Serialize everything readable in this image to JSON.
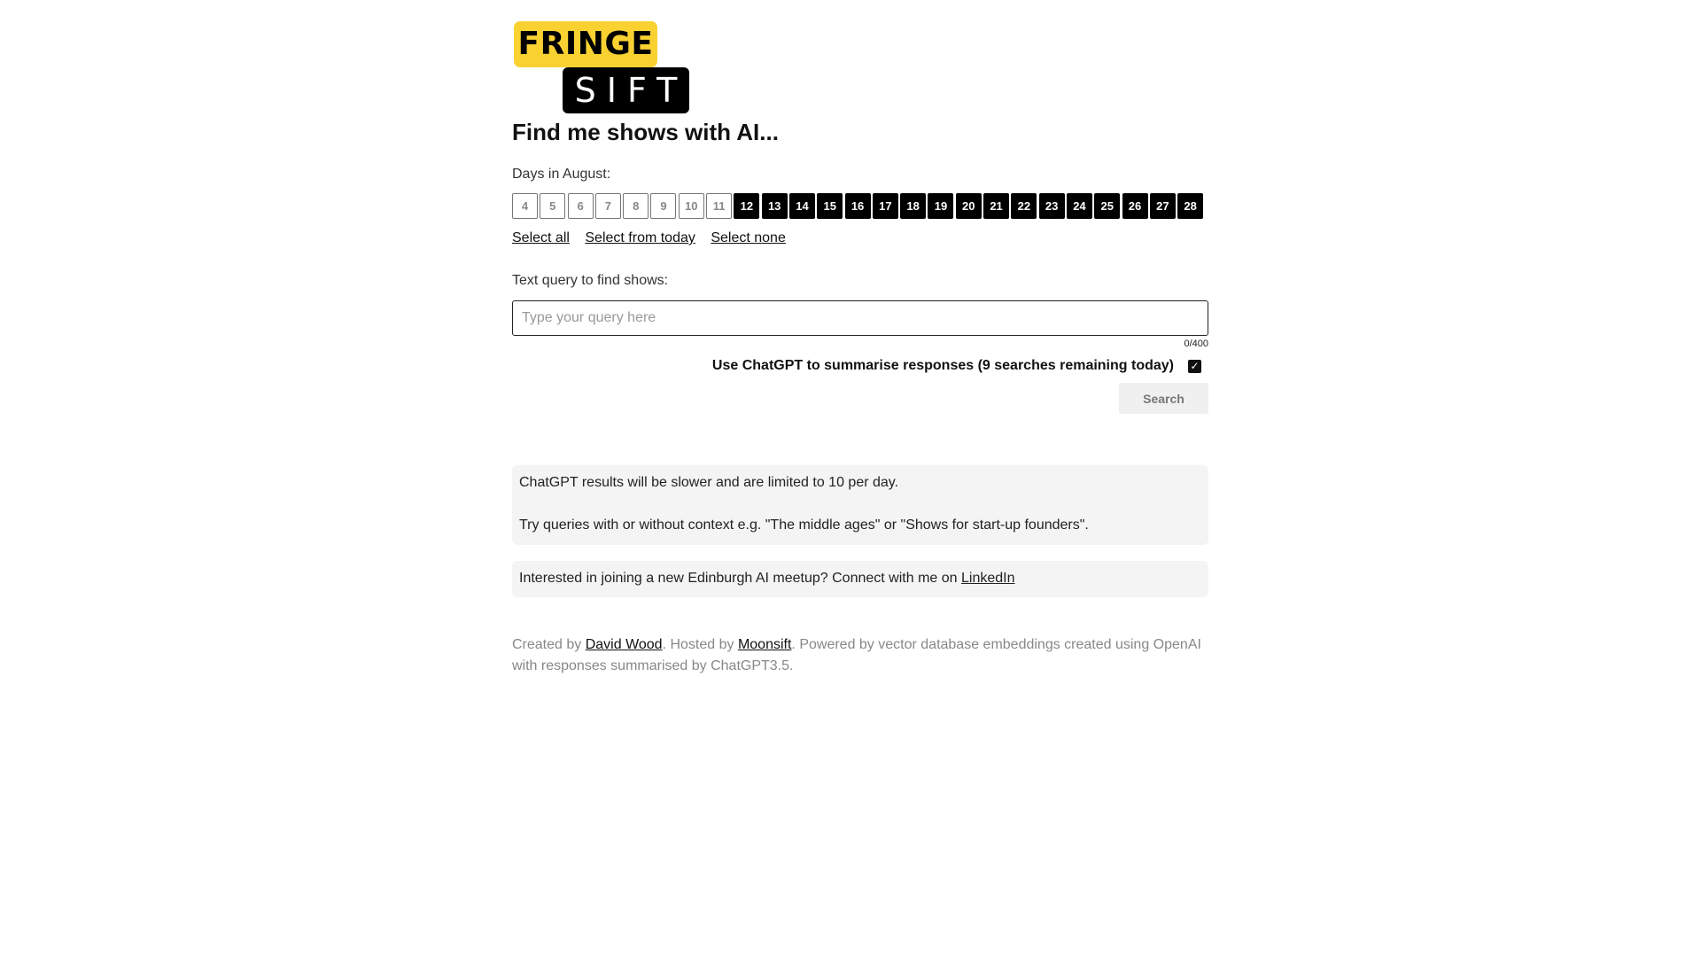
{
  "logo": {
    "top_word": "FRINGE",
    "bottom_word": "SIFT",
    "colors": {
      "top_bg": "#f9d232",
      "bottom_bg": "#000000"
    }
  },
  "heading": "Find me shows with AI...",
  "days": {
    "label": "Days in August:",
    "items": [
      {
        "label": "4",
        "selected": false
      },
      {
        "label": "5",
        "selected": false
      },
      {
        "label": "6",
        "selected": false
      },
      {
        "label": "7",
        "selected": false
      },
      {
        "label": "8",
        "selected": false
      },
      {
        "label": "9",
        "selected": false
      },
      {
        "label": "10",
        "selected": false
      },
      {
        "label": "11",
        "selected": false
      },
      {
        "label": "12",
        "selected": true
      },
      {
        "label": "13",
        "selected": true
      },
      {
        "label": "14",
        "selected": true
      },
      {
        "label": "15",
        "selected": true
      },
      {
        "label": "16",
        "selected": true
      },
      {
        "label": "17",
        "selected": true
      },
      {
        "label": "18",
        "selected": true
      },
      {
        "label": "19",
        "selected": true
      },
      {
        "label": "20",
        "selected": true
      },
      {
        "label": "21",
        "selected": true
      },
      {
        "label": "22",
        "selected": true
      },
      {
        "label": "23",
        "selected": true
      },
      {
        "label": "24",
        "selected": true
      },
      {
        "label": "25",
        "selected": true
      },
      {
        "label": "26",
        "selected": true
      },
      {
        "label": "27",
        "selected": true
      },
      {
        "label": "28",
        "selected": true
      }
    ],
    "select_all": "Select all",
    "select_from_today": "Select from today",
    "select_none": "Select none"
  },
  "query": {
    "label": "Text query to find shows:",
    "placeholder": "Type your query here",
    "value": "",
    "char_count": "0/400"
  },
  "chatgpt": {
    "label": "Use ChatGPT to summarise responses (9 searches remaining today)",
    "checked": true,
    "check_glyph": "✓"
  },
  "search_button": "Search",
  "info": {
    "line1": "ChatGPT results will be slower and are limited to 10 per day.",
    "line2": "Try queries with or without context e.g. \"The middle ages\" or \"Shows for start-up founders\".",
    "meetup_text": "Interested in joining a new Edinburgh AI meetup? Connect with me on ",
    "meetup_link": "LinkedIn"
  },
  "footer": {
    "created_by": "Created by ",
    "author_link": "David Wood",
    "hosted_by": ". Hosted by ",
    "host_link": "Moonsift",
    "powered": ". Powered by vector database embeddings created using OpenAI with responses summarised by ChatGPT3.5."
  }
}
